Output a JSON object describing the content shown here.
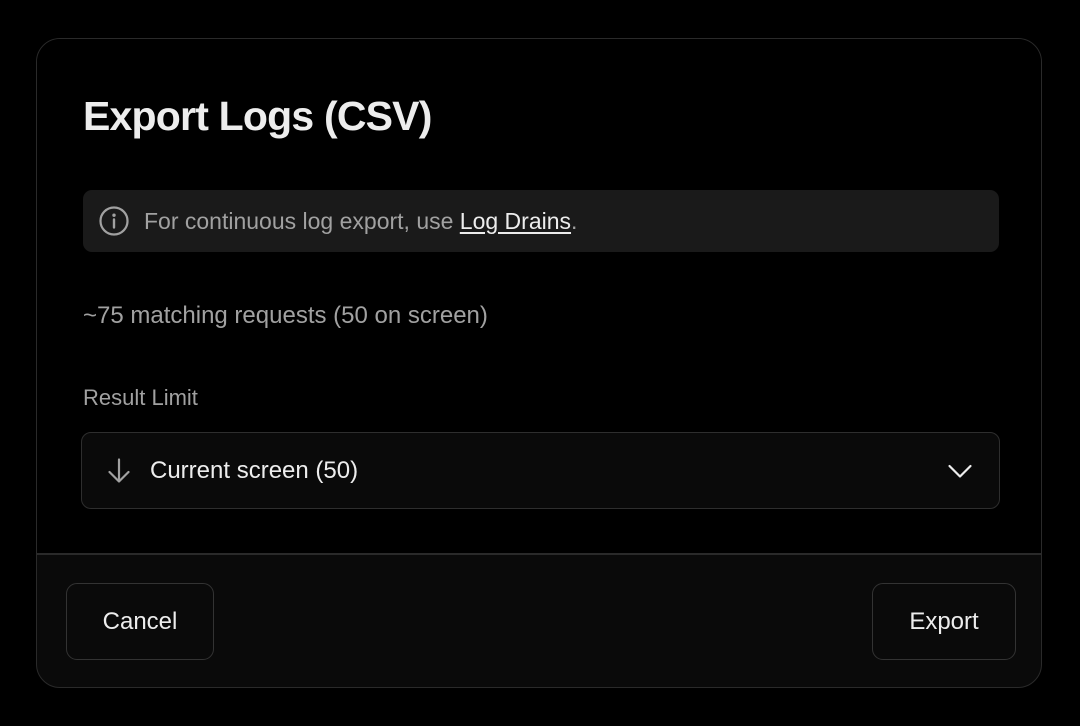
{
  "dialog": {
    "title": "Export Logs (CSV)",
    "notice": {
      "icon": "info-icon",
      "text": "For continuous log export, use ",
      "link_label": "Log Drains",
      "suffix": "."
    },
    "match_count": "~75 matching requests (50 on screen)",
    "result_limit": {
      "label": "Result Limit",
      "icon": "arrow-down-icon",
      "selected": "Current screen (50)",
      "chevron": "chevron-down-icon"
    },
    "footer": {
      "cancel_label": "Cancel",
      "export_label": "Export"
    }
  },
  "colors": {
    "background": "#000000",
    "surface": "#0a0a0a",
    "notice_bg": "#1a1a1a",
    "border": "#2a2a2a",
    "text_primary": "#ededed",
    "text_secondary": "#a1a1a1"
  }
}
